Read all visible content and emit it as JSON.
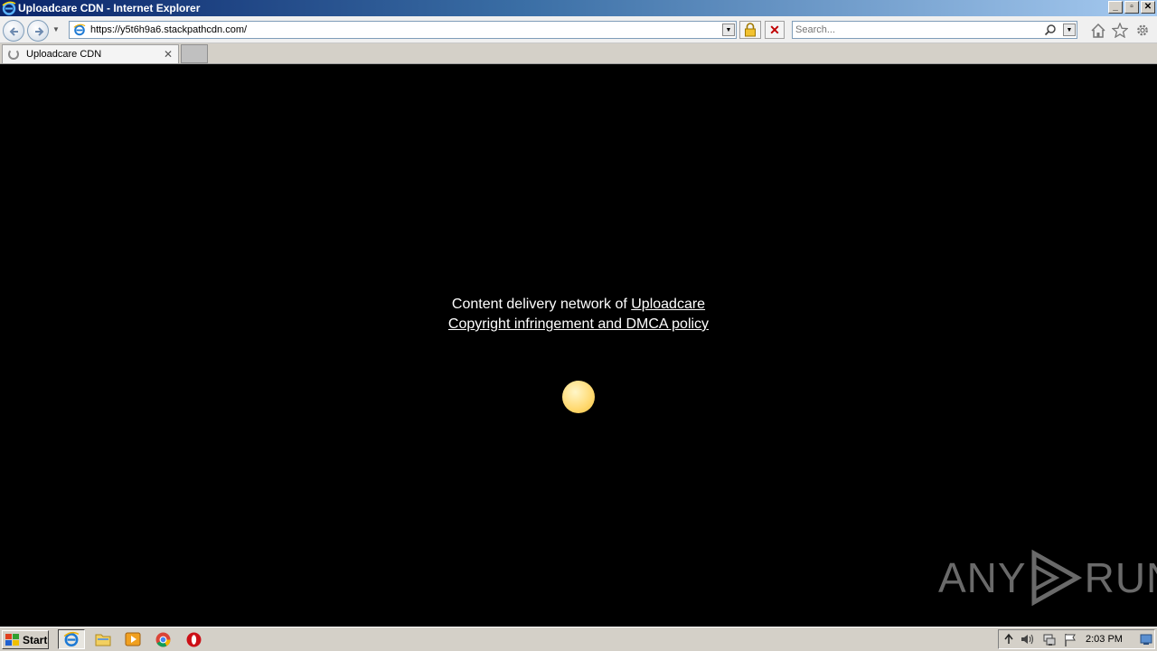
{
  "window": {
    "title": "Uploadcare CDN - Internet Explorer",
    "minimize_label": "_",
    "restore_label": "▫",
    "close_label": "✕"
  },
  "navbar": {
    "url": "https://y5t6h9a6.stackpathcdn.com/",
    "search_placeholder": "Search...",
    "stop_label": "✕"
  },
  "tabs": [
    {
      "label": "Uploadcare CDN",
      "close": "✕",
      "loading": true
    }
  ],
  "page": {
    "line1_prefix": "Content delivery network of ",
    "line1_link": "Uploadcare",
    "line2_link": "Copyright infringement and DMCA policy",
    "loader_color": "#ffd970",
    "background": "#000000"
  },
  "watermark": {
    "left": "ANY",
    "right": "RUN"
  },
  "taskbar": {
    "start_label": "Start",
    "clock": "2:03 PM"
  },
  "icons": {
    "back": "back-arrow-icon",
    "forward": "forward-arrow-icon",
    "home": "home-icon",
    "favorites": "star-icon",
    "tools": "gear-icon",
    "lock": "lock-icon",
    "search": "magnifier-icon"
  }
}
